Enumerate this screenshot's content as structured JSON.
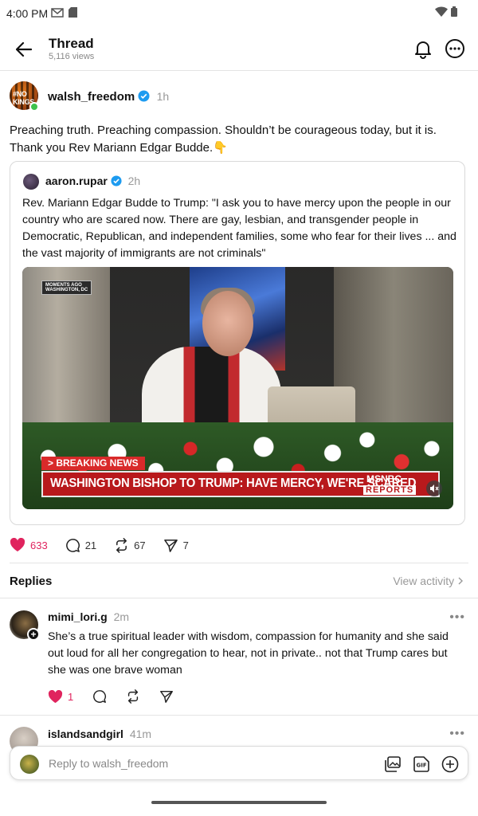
{
  "status_bar": {
    "time": "4:00 PM"
  },
  "header": {
    "title": "Thread",
    "views": "5,116 views"
  },
  "post": {
    "avatar_text": "#NO KINGS",
    "author": "walsh_freedom",
    "time": "1h",
    "text": "Preaching truth. Preaching compassion. Shouldn’t be courageous today, but it is. Thank you Rev Mariann Edgar Budde.👇",
    "likes": "633",
    "replies": "21",
    "reposts": "67",
    "shares": "7"
  },
  "quote": {
    "author": "aaron.rupar",
    "time": "2h",
    "text": "Rev. Mariann Edgar Budde to Trump: \"I ask you to have mercy upon the people in our country who are scared now. There are gay, lesbian, and transgender people in Democratic, Republican, and independent families, some who fear for their lives ... and the vast majority of immigrants are not criminals\"",
    "image": {
      "tag_line1": "MOMENTS AGO",
      "tag_line2": "WASHINGTON, DC",
      "breaking": "> BREAKING NEWS",
      "headline": "WASHINGTON BISHOP TO TRUMP: HAVE MERCY, WE'RE SCARED",
      "network": "MSNBC",
      "network_sub": "REPORTS"
    }
  },
  "replies_section": {
    "label": "Replies",
    "view_activity": "View activity"
  },
  "replies": [
    {
      "author": "mimi_lori.g",
      "time": "2m",
      "text": "She’s a true spiritual leader with wisdom, compassion for humanity and she said out loud for all her congregation to hear, not in private.. not that Trump cares but she was one brave woman",
      "likes": "1"
    },
    {
      "author": "islandsandgirl",
      "time": "41m"
    }
  ],
  "composer": {
    "placeholder": "Reply to walsh_freedom"
  },
  "colors": {
    "like": "#e0245e",
    "verified": "#1d9bf0",
    "online": "#3ec24c"
  }
}
